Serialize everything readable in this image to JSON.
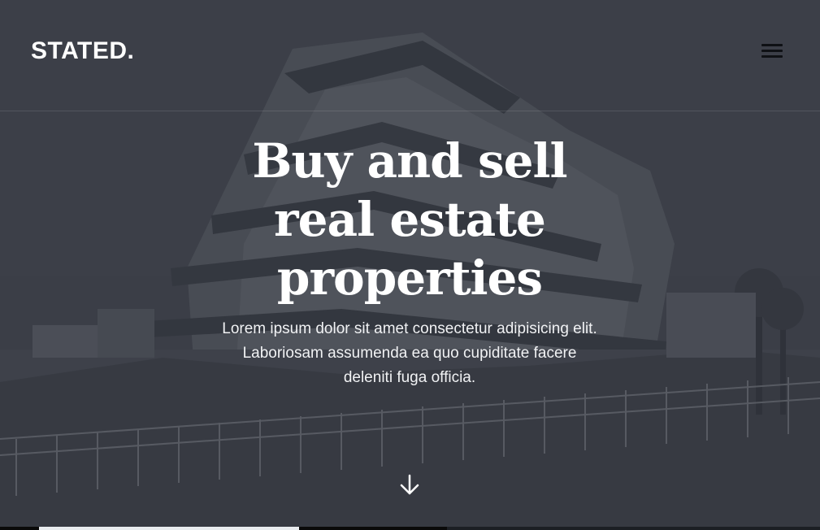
{
  "header": {
    "logo": "STATED.",
    "menu_icon": "hamburger-menu-icon"
  },
  "hero": {
    "headline_lines": [
      "Buy and sell",
      "real estate",
      "properties"
    ],
    "subtext": "Lorem ipsum dolor sit amet consectetur adipisicing elit. Laboriosam assumenda ea quo cupiditate facere deleniti fuga officia.",
    "scroll_icon": "arrow-down-icon"
  },
  "colors": {
    "overlay": "#434750",
    "text": "#ffffff",
    "menu_icon": "#0f1115"
  }
}
